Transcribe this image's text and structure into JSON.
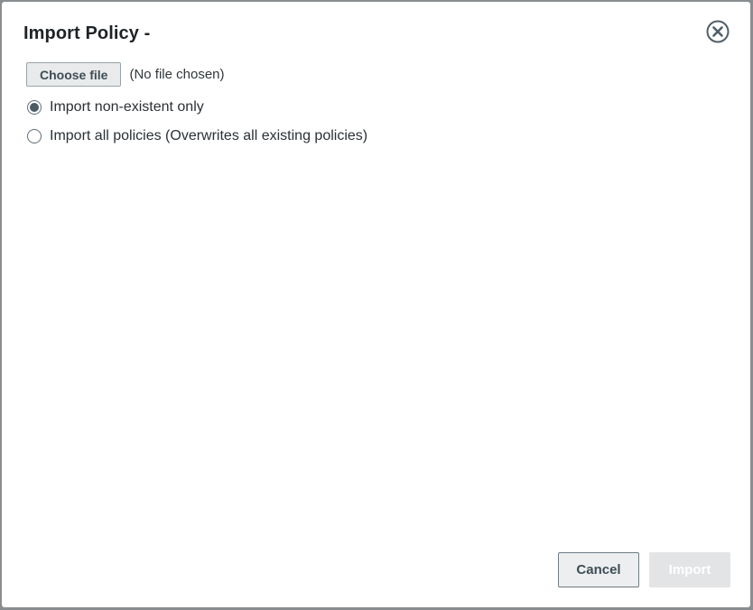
{
  "dialog": {
    "title": "Import Policy -",
    "close_icon": "close-circle-icon"
  },
  "file_input": {
    "button_label": "Choose file",
    "status": "(No file chosen)"
  },
  "options": [
    {
      "label": "Import non-existent only",
      "selected": true
    },
    {
      "label": "Import all policies (Overwrites all existing policies)",
      "selected": false
    }
  ],
  "footer": {
    "cancel_label": "Cancel",
    "import_label": "Import",
    "import_enabled": false
  },
  "colors": {
    "accent": "#4d5b63",
    "disabled": "#e3e4e5"
  }
}
